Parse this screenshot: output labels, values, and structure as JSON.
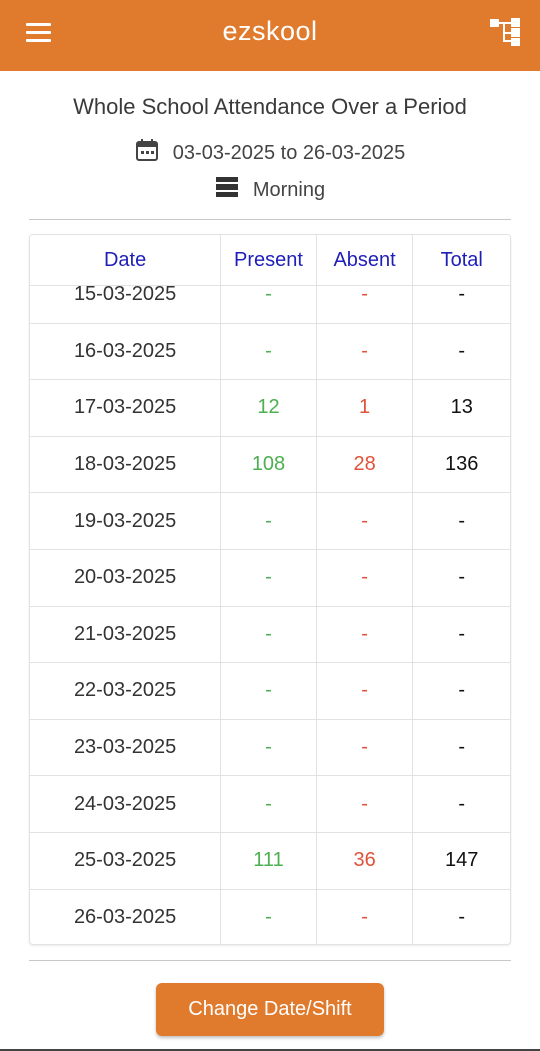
{
  "appbar": {
    "title": "ezskool",
    "menu_icon": "hamburger-menu-icon",
    "right_icon": "hierarchy-tree-icon",
    "color": "#e07b2e"
  },
  "report": {
    "title": "Whole School Attendance Over a Period",
    "date_range": "03-03-2025 to 26-03-2025",
    "shift": "Morning"
  },
  "table": {
    "headers": {
      "date": "Date",
      "present": "Present",
      "absent": "Absent",
      "total": "Total"
    },
    "rows": [
      {
        "date": "15-03-2025",
        "present": "-",
        "absent": "-",
        "total": "-"
      },
      {
        "date": "16-03-2025",
        "present": "-",
        "absent": "-",
        "total": "-"
      },
      {
        "date": "17-03-2025",
        "present": "12",
        "absent": "1",
        "total": "13"
      },
      {
        "date": "18-03-2025",
        "present": "108",
        "absent": "28",
        "total": "136"
      },
      {
        "date": "19-03-2025",
        "present": "-",
        "absent": "-",
        "total": "-"
      },
      {
        "date": "20-03-2025",
        "present": "-",
        "absent": "-",
        "total": "-"
      },
      {
        "date": "21-03-2025",
        "present": "-",
        "absent": "-",
        "total": "-"
      },
      {
        "date": "22-03-2025",
        "present": "-",
        "absent": "-",
        "total": "-"
      },
      {
        "date": "23-03-2025",
        "present": "-",
        "absent": "-",
        "total": "-"
      },
      {
        "date": "24-03-2025",
        "present": "-",
        "absent": "-",
        "total": "-"
      },
      {
        "date": "25-03-2025",
        "present": "111",
        "absent": "36",
        "total": "147"
      },
      {
        "date": "26-03-2025",
        "present": "-",
        "absent": "-",
        "total": "-"
      }
    ]
  },
  "actions": {
    "change_label": "Change Date/Shift"
  },
  "colors": {
    "accent": "#e07b2e",
    "header_text": "#1f1fb8",
    "present": "#4caf50",
    "absent": "#e0533a"
  }
}
